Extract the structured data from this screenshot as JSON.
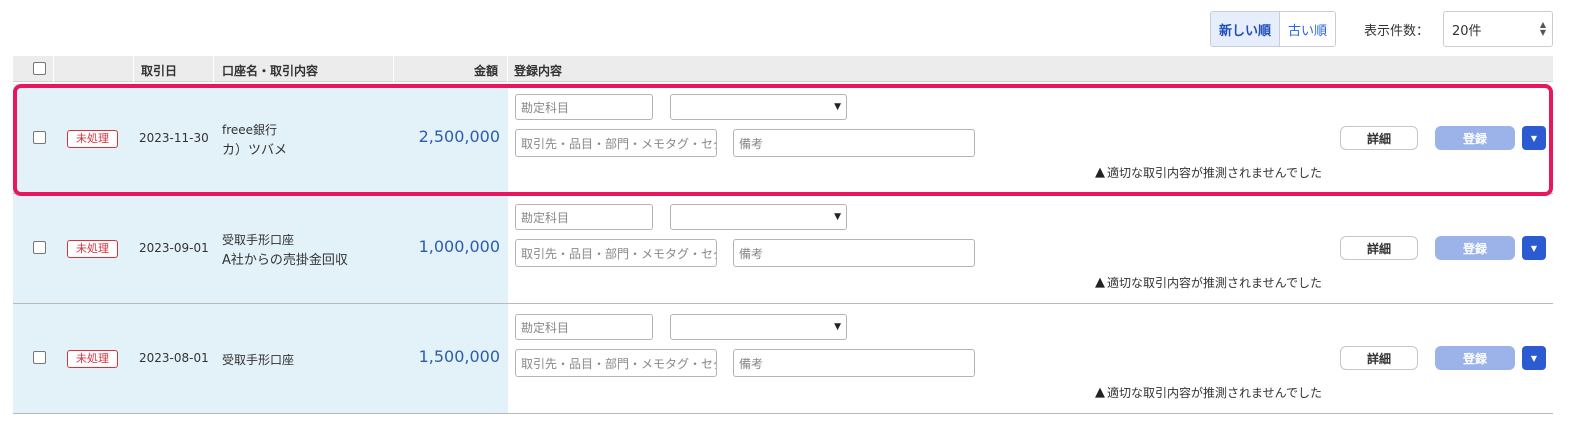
{
  "toolbar": {
    "sort_newest": "新しい順",
    "sort_oldest": "古い順",
    "count_label": "表示件数：",
    "count_value": "20件"
  },
  "header": {
    "date": "取引日",
    "account": "口座名・取引内容",
    "amount": "金額",
    "registration": "登録内容"
  },
  "rows": [
    {
      "status": "未処理",
      "date": "2023-11-30",
      "account": "freee銀行",
      "description": "カ）ツバメ",
      "amount": "2,500,000",
      "account_item_placeholder": "勘定科目",
      "partner_placeholder": "取引先・品目・部門・メモタグ・セグメント",
      "memo_placeholder": "備考",
      "warning": "適切な取引内容が推測されませんでした",
      "detail_label": "詳細",
      "register_label": "登録"
    },
    {
      "status": "未処理",
      "date": "2023-09-01",
      "account": "受取手形口座",
      "description": "A社からの売掛金回収",
      "amount": "1,000,000",
      "account_item_placeholder": "勘定科目",
      "partner_placeholder": "取引先・品目・部門・メモタグ・セグメント",
      "memo_placeholder": "備考",
      "warning": "適切な取引内容が推測されませんでした",
      "detail_label": "詳細",
      "register_label": "登録"
    },
    {
      "status": "未処理",
      "date": "2023-08-01",
      "account": "受取手形口座",
      "description": "",
      "amount": "1,500,000",
      "account_item_placeholder": "勘定科目",
      "partner_placeholder": "取引先・品目・部門・メモタグ・セグメント",
      "memo_placeholder": "備考",
      "warning": "適切な取引内容が推測されませんでした",
      "detail_label": "詳細",
      "register_label": "登録"
    }
  ],
  "colors": {
    "highlight": "#e8175d",
    "accent": "#2c5bd1",
    "status": "#d9303c"
  }
}
